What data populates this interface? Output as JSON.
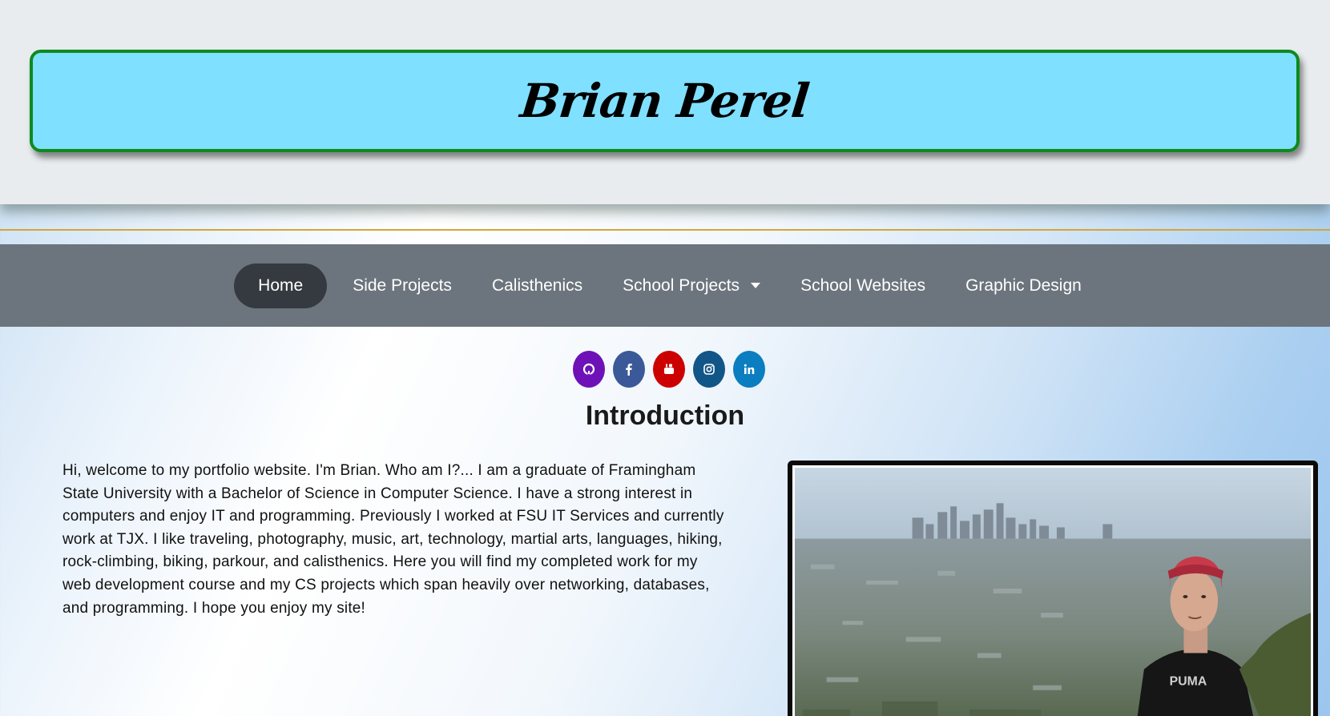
{
  "header": {
    "title": "Brian Perel"
  },
  "nav": {
    "items": [
      {
        "label": "Home",
        "active": true
      },
      {
        "label": "Side Projects"
      },
      {
        "label": "Calisthenics"
      },
      {
        "label": "School Projects",
        "dropdown": true
      },
      {
        "label": "School Websites"
      },
      {
        "label": "Graphic Design"
      }
    ]
  },
  "social": [
    {
      "name": "github-icon",
      "glyph": "◎",
      "color": "#6e12b8"
    },
    {
      "name": "facebook-icon",
      "glyph": "f",
      "color": "#3b5998"
    },
    {
      "name": "youtube-icon",
      "glyph": "▶",
      "color": "#cc0000"
    },
    {
      "name": "instagram-icon",
      "glyph": "◻",
      "color": "#125688"
    },
    {
      "name": "linkedin-icon",
      "glyph": "in",
      "color": "#0a7ec0"
    }
  ],
  "intro": {
    "heading": "Introduction",
    "body": "Hi, welcome to my portfolio website. I'm Brian. Who am I?... I am a graduate of Framingham State University with a Bachelor of Science in Computer Science. I have a strong interest in computers and enjoy IT and programming. Previously I worked at FSU IT Services and currently work at TJX. I like traveling, photography, music, art, technology, martial arts, languages, hiking, rock-climbing, biking, parkour, and calisthenics. Here you will find my completed work for my web development course and my CS projects which span heavily over networking, databases, and programming. I hope you enjoy my site!"
  },
  "photo": {
    "shirt_text": "PUMA"
  }
}
